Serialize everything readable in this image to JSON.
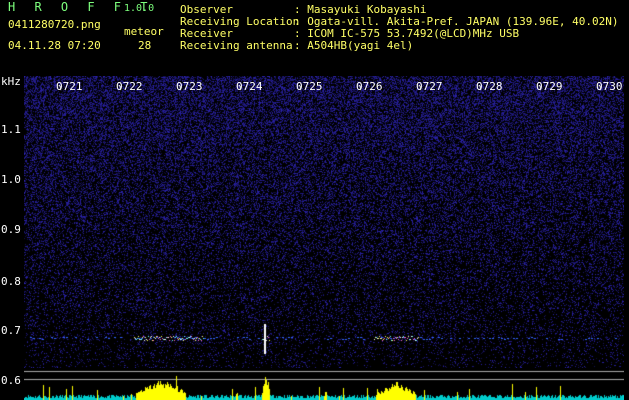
{
  "header": {
    "app_name": "H R O F F T",
    "version": "1.0.0",
    "file_name": "0411280720.png",
    "event_label": "meteor",
    "date_time": "04.11.28 07:20",
    "event_count": "28"
  },
  "info": [
    {
      "key": "Observer",
      "value": ": Masayuki Kobayashi"
    },
    {
      "key": "Receiving Location",
      "value": ": Ogata-vill. Akita-Pref. JAPAN (139.96E, 40.02N)"
    },
    {
      "key": "Receiver",
      "value": ": ICOM IC-575 53.7492(@LCD)MHz USB"
    },
    {
      "key": "Receiving antenna",
      "value": ": A504HB(yagi 4el)"
    }
  ],
  "axis": {
    "unit": "kHz",
    "time_ticks": [
      "0721",
      "0722",
      "0723",
      "0724",
      "0725",
      "0726",
      "0727",
      "0728",
      "0729",
      "0730"
    ],
    "freq_ticks": [
      "1.1",
      "1.0",
      "0.9",
      "0.8",
      "0.7",
      "0.6"
    ]
  },
  "colors": {
    "background": "#000000",
    "noise": "#1a1a8c",
    "echo": "#ff66cc",
    "meter_bar": "#ffff00",
    "meter_base": "#00cccc",
    "label_green": "#7dff7d",
    "label_yellow": "#ffff66"
  }
}
